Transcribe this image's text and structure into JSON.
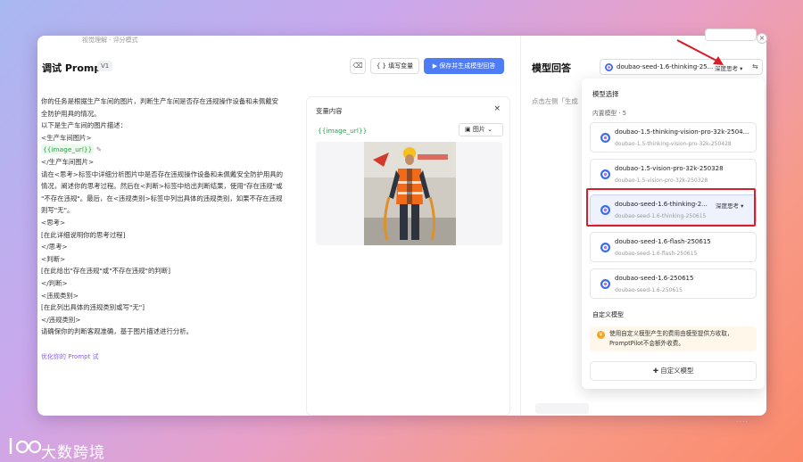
{
  "crumb": "视觉理解 · 评分模式",
  "left": {
    "title": "调试 Prompt",
    "version": "V1",
    "fill_var_label": "填写变量",
    "save_label": "保存并生成模型回答",
    "prompt_lines": [
      "你的任务是根据生产车间的图片，判断生产车间是否存在违规操作设备和未佩戴安",
      "全防护用具的情况。",
      "以下是生产车间的图片描述：",
      "<生产车间图片>",
      "{{image_url}}",
      "</生产车间图片>",
      "请在<思考>标签中详细分析图片中是否存在违规操作设备和未佩戴安全防护用具的",
      "情况，阐述你的思考过程。然后在<判断>标签中给出判断结果，使用\"存在违规\"或",
      "\"不存在违规\"。最后，在<违规类别>标签中列出具体的违规类别，如果不存在违规",
      "则写\"无\"。",
      "<思考>",
      "[在此详细说明你的思考过程]",
      "</思考>",
      "<判断>",
      "[在此给出\"存在违规\"或\"不存在违规\"的判断]",
      "</判断>",
      "<违规类别>",
      "[在此列出具体的违规类别或写\"无\"]",
      "</违规类别>",
      "请确保你的判断客观准确，基于图片描述进行分析。"
    ],
    "optimize_label": "优化你的 Prompt 试",
    "var_panel": {
      "title": "变量内容",
      "close": "×",
      "var_name": "{{image_url}}",
      "type_label": "图片"
    }
  },
  "right": {
    "title": "模型回答",
    "selected_model": "doubao-seed-1.6-thinking-25...",
    "deep_think": "深度思考",
    "hint": "点击左侧「生成"
  },
  "dropdown": {
    "title": "模型选择",
    "builtin_label": "内置模型 · 5",
    "models": [
      {
        "name": "doubao-1.5-thinking-vision-pro-32k-2504...",
        "id": "doubao-1.5-thinking-vision-pro-32k-250428"
      },
      {
        "name": "doubao-1.5-vision-pro-32k-250328",
        "id": "doubao-1.5-vision-pro-32k-250328"
      },
      {
        "name": "doubao-seed-1.6-thinking-2...",
        "id": "doubao-seed-1.6-thinking-250615",
        "deep": "深度思考"
      },
      {
        "name": "doubao-seed-1.6-flash-250615",
        "id": "doubao-seed-1.6-flash-250615"
      },
      {
        "name": "doubao-seed-1.6-250615",
        "id": "doubao-seed-1.6-250615"
      }
    ],
    "custom_label": "自定义模型",
    "notice": "使用自定义模型产生的费用由模型提供方收取，PromptPilot不会额外收费。",
    "add_label": "自定义模型"
  },
  "watermark": "大数跨境",
  "colors": {
    "accent": "#4e7cf6",
    "highlight_box": "#d81e2a",
    "var_green": "#2a9d4a"
  }
}
